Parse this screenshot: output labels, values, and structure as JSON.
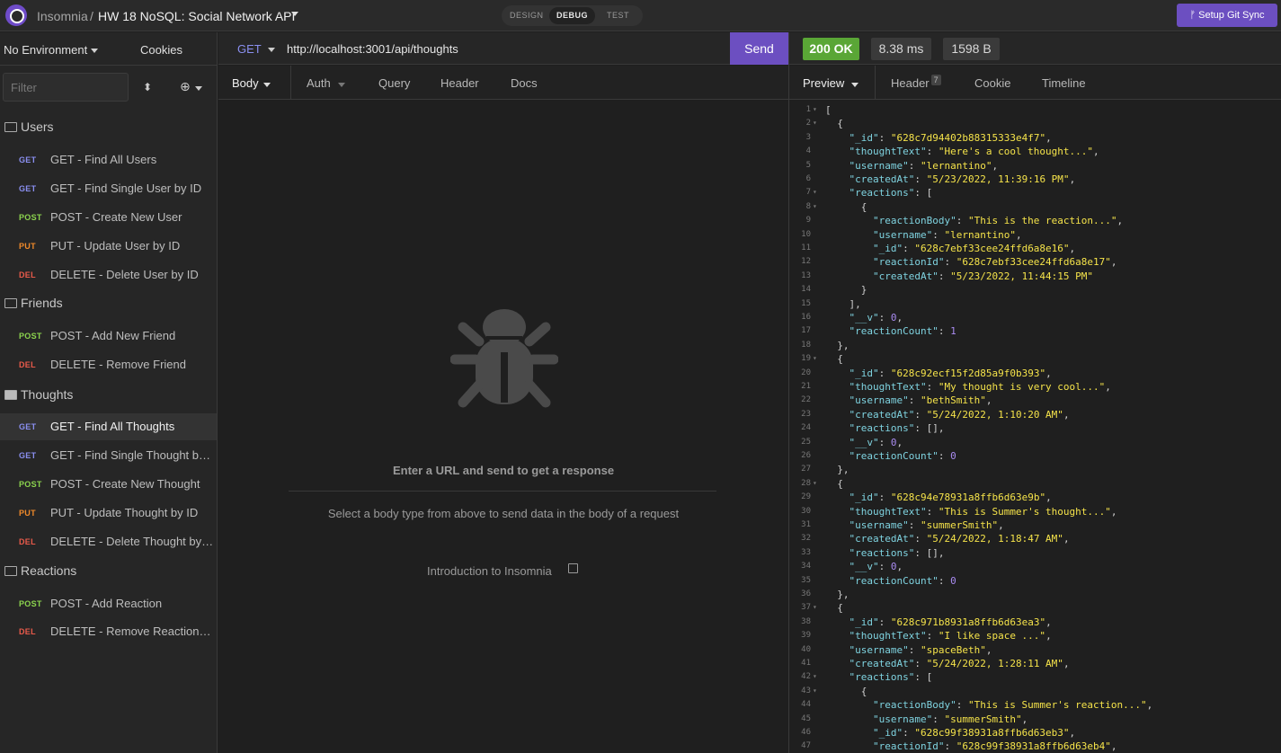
{
  "app": {
    "name": "Insomnia",
    "separator": "/",
    "workspace": "HW 18 NoSQL: Social Network API",
    "modes": [
      "DESIGN",
      "DEBUG",
      "TEST"
    ],
    "active_mode": "DEBUG",
    "git_sync_label": "ᚠ Setup Git Sync",
    "accent_color": "#6c4fc1"
  },
  "sidebar": {
    "environment": "No Environment",
    "cookies": "Cookies",
    "filter_placeholder": "Filter",
    "folders": [
      {
        "name": "Users",
        "requests": [
          {
            "verb": "GET",
            "name": "GET - Find All Users"
          },
          {
            "verb": "GET",
            "name": "GET - Find Single User by ID"
          },
          {
            "verb": "POST",
            "name": "POST - Create New User"
          },
          {
            "verb": "PUT",
            "name": "PUT - Update User by ID"
          },
          {
            "verb": "DEL",
            "name": "DELETE - Delete User by ID"
          }
        ]
      },
      {
        "name": "Friends",
        "requests": [
          {
            "verb": "POST",
            "name": "POST - Add New Friend"
          },
          {
            "verb": "DEL",
            "name": "DELETE - Remove Friend"
          }
        ]
      },
      {
        "name": "Thoughts",
        "requests": [
          {
            "verb": "GET",
            "name": "GET - Find All Thoughts"
          },
          {
            "verb": "GET",
            "name": "GET - Find Single Thought by ID"
          },
          {
            "verb": "POST",
            "name": "POST - Create New Thought"
          },
          {
            "verb": "PUT",
            "name": "PUT - Update Thought by ID"
          },
          {
            "verb": "DEL",
            "name": "DELETE - Delete Thought by ID"
          }
        ]
      },
      {
        "name": "Reactions",
        "requests": [
          {
            "verb": "POST",
            "name": "POST - Add Reaction"
          },
          {
            "verb": "DEL",
            "name": "DELETE - Remove Reaction by ID"
          }
        ]
      }
    ]
  },
  "request": {
    "method": "GET",
    "url": "http://localhost:3001/api/thoughts",
    "send_label": "Send",
    "tabs": [
      "Body",
      "Auth",
      "Query",
      "Header",
      "Docs"
    ],
    "empty_title": "Enter a URL and send to get a response",
    "empty_subtitle": "Select a body type from above to send data in the body of a request",
    "intro_link": "Introduction to Insomnia"
  },
  "response": {
    "status": "200 OK",
    "time": "8.38 ms",
    "size": "1598 B",
    "tabs": [
      "Preview",
      "Header",
      "Cookie",
      "Timeline"
    ],
    "header_count": "7",
    "lines": [
      "[",
      "  {",
      "    \"_id\": \"628c7d94402b88315333e4f7\",",
      "    \"thoughtText\": \"Here's a cool thought...\",",
      "    \"username\": \"lernantino\",",
      "    \"createdAt\": \"5/23/2022, 11:39:16 PM\",",
      "    \"reactions\": [",
      "      {",
      "        \"reactionBody\": \"This is the reaction...\",",
      "        \"username\": \"lernantino\",",
      "        \"_id\": \"628c7ebf33cee24ffd6a8e16\",",
      "        \"reactionId\": \"628c7ebf33cee24ffd6a8e17\",",
      "        \"createdAt\": \"5/23/2022, 11:44:15 PM\"",
      "      }",
      "    ],",
      "    \"__v\": 0,",
      "    \"reactionCount\": 1",
      "  },",
      "  {",
      "    \"_id\": \"628c92ecf15f2d85a9f0b393\",",
      "    \"thoughtText\": \"My thought is very cool...\",",
      "    \"username\": \"bethSmith\",",
      "    \"createdAt\": \"5/24/2022, 1:10:20 AM\",",
      "    \"reactions\": [],",
      "    \"__v\": 0,",
      "    \"reactionCount\": 0",
      "  },",
      "  {",
      "    \"_id\": \"628c94e78931a8ffb6d63e9b\",",
      "    \"thoughtText\": \"This is Summer's thought...\",",
      "    \"username\": \"summerSmith\",",
      "    \"createdAt\": \"5/24/2022, 1:18:47 AM\",",
      "    \"reactions\": [],",
      "    \"__v\": 0,",
      "    \"reactionCount\": 0",
      "  },",
      "  {",
      "    \"_id\": \"628c971b8931a8ffb6d63ea3\",",
      "    \"thoughtText\": \"I like space ...\",",
      "    \"username\": \"spaceBeth\",",
      "    \"createdAt\": \"5/24/2022, 1:28:11 AM\",",
      "    \"reactions\": [",
      "      {",
      "        \"reactionBody\": \"This is Summer's reaction...\",",
      "        \"username\": \"summerSmith\",",
      "        \"_id\": \"628c99f38931a8ffb6d63eb3\",",
      "        \"reactionId\": \"628c99f38931a8ffb6d63eb4\","
    ],
    "fold_lines": [
      1,
      2,
      7,
      8,
      19,
      28,
      37,
      42,
      43
    ]
  }
}
